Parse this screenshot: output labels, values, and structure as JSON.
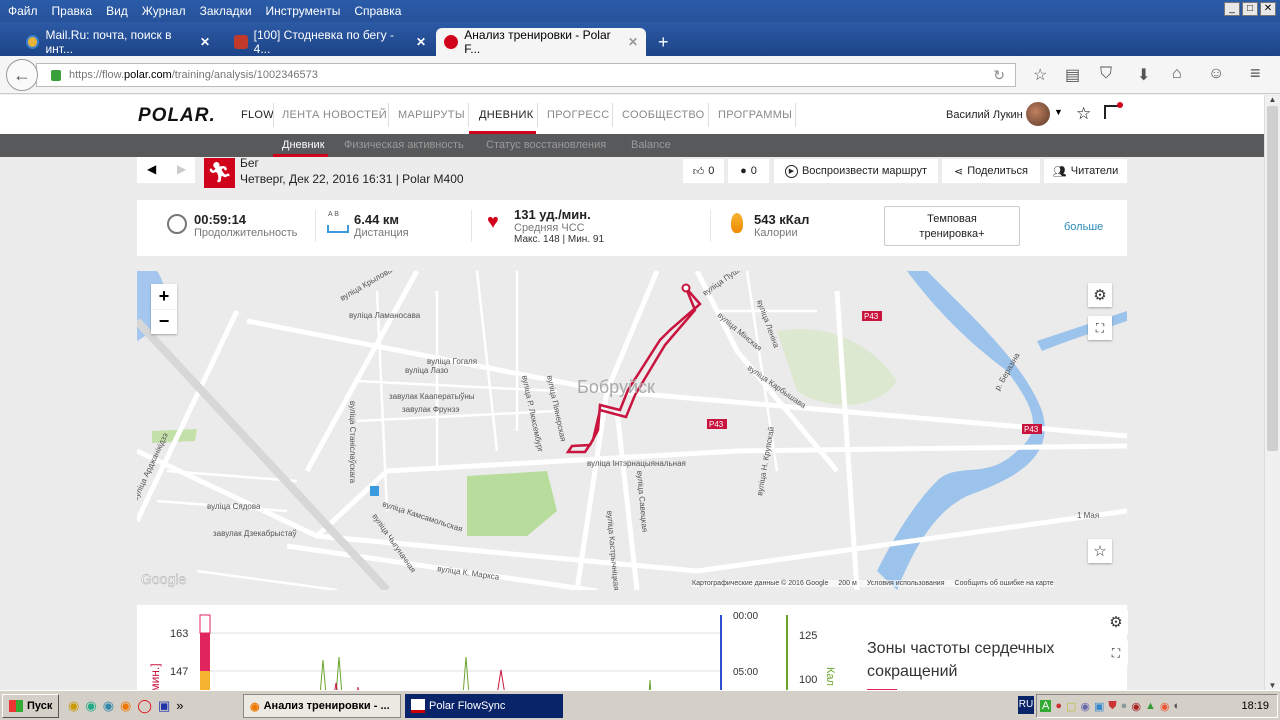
{
  "menu": [
    "Файл",
    "Правка",
    "Вид",
    "Журнал",
    "Закладки",
    "Инструменты",
    "Справка"
  ],
  "tabs": [
    {
      "title": "Mail.Ru: почта, поиск в инт...",
      "icon": "mailru-icon"
    },
    {
      "title": "[100] Стодневка по бегу - 4...",
      "icon": "running-icon"
    },
    {
      "title": "Анализ тренировки - Polar F...",
      "icon": "polar-icon"
    }
  ],
  "url": {
    "prefix": "https://flow.",
    "domain": "polar.com",
    "path": "/training/analysis/1002346573"
  },
  "site": {
    "logo": "POLAR.",
    "flow": "FLOW",
    "nav": [
      "ЛЕНТА НОВОСТЕЙ",
      "МАРШРУТЫ",
      "ДНЕВНИК",
      "ПРОГРЕСС",
      "СООБЩЕСТВО",
      "ПРОГРАММЫ"
    ],
    "user": "Василий Лукин",
    "subnav": [
      "Дневник",
      "Физическая активность",
      "Статус восстановления",
      "Balance"
    ]
  },
  "session": {
    "sport": "Бег",
    "date": "Четверг, Дек 22, 2016 16:31 | Polar M400",
    "likes": "0",
    "comments": "0",
    "replay": "Воспроизвести маршрут",
    "share": "Поделиться",
    "followers": "Читатели"
  },
  "stats": {
    "duration": "00:59:14",
    "duration_label": "Продолжительность",
    "distance": "6.44 км",
    "distance_label": "Дистанция",
    "ab": "A  B",
    "hr": "131 уд./мин.",
    "hr_label": "Средняя ЧСС",
    "hr_minmax": "Макс. 148  |  Мин. 91",
    "calories": "543 кКал",
    "calories_label": "Калории",
    "type": "Темповая тренировка+",
    "more": "больше"
  },
  "map": {
    "city": "Бобруйск",
    "streets": [
      "вуліца Гогаля",
      "вуліца Ламаносава",
      "вуліца Крылова",
      "вуліца Лазо",
      "завулак Кааператыўны",
      "завулак Фрунзэ",
      "вуліца Інтэрнацыянальная",
      "вуліца Камсамольская",
      "вуліца К. Маркса",
      "вуліца Сядова",
      "завулак Дзекабрыстаў",
      "вуліца Чыгуначная",
      "вуліца Мінская",
      "вуліца Пушкіна",
      "вуліца Савецкая",
      "вуліца Кастрычніцкая",
      "вуліца Арджанікідзэ",
      "вуліца Станіслаўскага",
      "вуліца Р. Люксембург",
      "вуліца Піянерская",
      "вуліца Леніна",
      "вуліца Карбышава",
      "вуліца Н. Крупскай",
      "1 Мая",
      "р. Беразіна"
    ],
    "road": "P43",
    "google": "Google",
    "attribution": "Картографические данные © 2016 Google",
    "scale": "200 м",
    "terms": "Условия использования",
    "report": "Сообщить об ошибке на карте"
  },
  "chart_data": {
    "type": "line",
    "y_left_ticks": [
      "163",
      "147"
    ],
    "y_left_label": "/мин.]",
    "y_right_time": [
      "00:00",
      "05:00"
    ],
    "y_right_ticks": [
      "125",
      "100"
    ],
    "y_right_label": "Кал",
    "hr_zone_colors": [
      "#e0245e",
      "#f6b332"
    ]
  },
  "zones": {
    "title": "Зоны частоты сердечных сокращений"
  },
  "taskbar": {
    "start": "Пуск",
    "tasks": [
      "Анализ тренировки - ...",
      "Polar FlowSync"
    ],
    "lang": "RU",
    "time": "18:19"
  }
}
